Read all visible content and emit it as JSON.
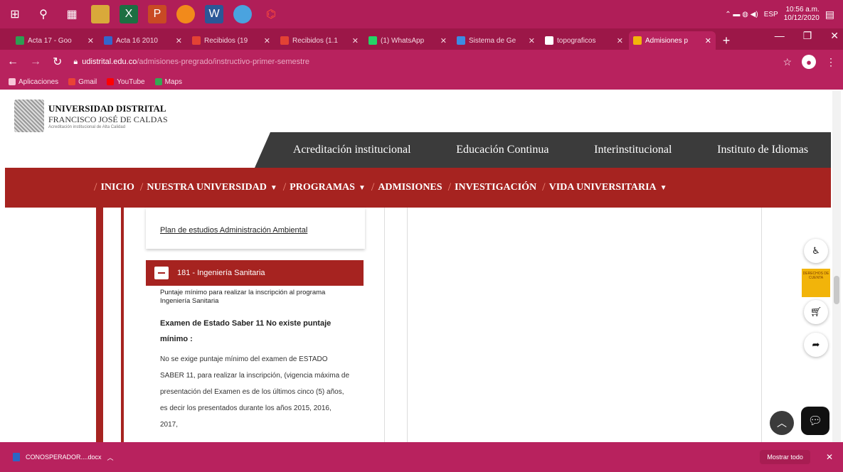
{
  "taskbar": {
    "clock_time": "10:56 a.m.",
    "clock_date": "10/12/2020",
    "lang": "ESP"
  },
  "tabs": [
    {
      "label": "Acta 17 - Goo",
      "color": "#2e9e53"
    },
    {
      "label": "Acta 16 2010",
      "color": "#3366cc"
    },
    {
      "label": "Recibidos (19",
      "color": "#e34234"
    },
    {
      "label": "Recibidos (1.1",
      "color": "#e34234"
    },
    {
      "label": "(1) WhatsApp",
      "color": "#25d366"
    },
    {
      "label": "Sistema de Ge",
      "color": "#3d8be3"
    },
    {
      "label": "topograficos",
      "color": "#ffffff"
    },
    {
      "label": "Admisiones p",
      "color": "#f2b40a",
      "active": true
    }
  ],
  "address": {
    "host": "udistrital.edu.co",
    "path": "/admisiones-pregrado/instructivo-primer-semestre"
  },
  "bookmarks": [
    {
      "label": "Aplicaciones",
      "color": "#f7c6d8"
    },
    {
      "label": "Gmail",
      "color": "#ea4335"
    },
    {
      "label": "YouTube",
      "color": "#ff0000"
    },
    {
      "label": "Maps",
      "color": "#34a853"
    }
  ],
  "logo": {
    "line1": "UNIVERSIDAD DISTRITAL",
    "line2": "FRANCISCO JOSÉ DE CALDAS",
    "line3": "Acreditación institucional de Alta Calidad"
  },
  "topnav": [
    "Acreditación institucional",
    "Educación Continua",
    "Interinstitucional",
    "Instituto de Idiomas"
  ],
  "mainnav": [
    {
      "label": "INICIO",
      "caret": false
    },
    {
      "label": "NUESTRA UNIVERSIDAD",
      "caret": true
    },
    {
      "label": "PROGRAMAS",
      "caret": true
    },
    {
      "label": "ADMISIONES",
      "caret": false
    },
    {
      "label": "INVESTIGACIÓN",
      "caret": false
    },
    {
      "label": "VIDA UNIVERSITARIA",
      "caret": true
    }
  ],
  "card1": {
    "link": "Plan de estudios Administración Ambiental"
  },
  "accordion": {
    "title": "181 - Ingeniería Sanitaria",
    "intro": "Puntaje mínimo para realizar la inscripción al programa Ingeniería Sanitaria",
    "heading": "Examen de Estado Saber 11 No existe puntaje mínimo :",
    "body": "No se exige puntaje mínimo del examen de ESTADO SABER 11, para realizar la inscripción, (vigencia máxima de presentación del Examen es de los últimos cinco (5) años, es decir los presentados durante los años 2015, 2016, 2017,"
  },
  "badge": "DERECHOS DE CUENTA",
  "download": {
    "file": "CONOSPERADOR....docx",
    "show_all": "Mostrar todo"
  }
}
